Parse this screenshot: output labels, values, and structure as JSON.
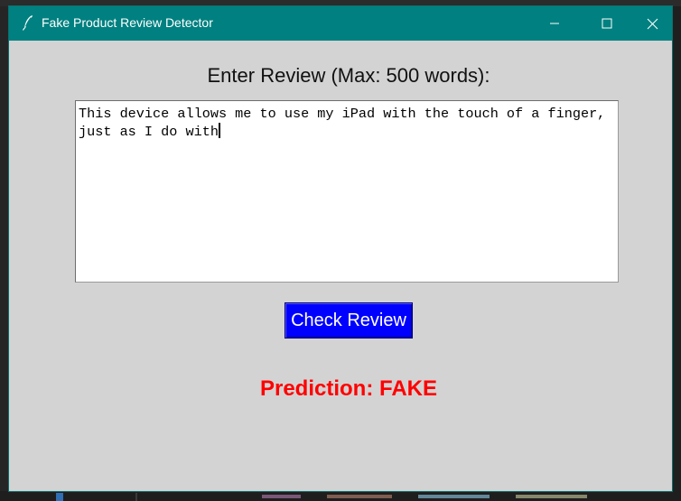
{
  "window": {
    "title": "Fake Product Review Detector",
    "titlebar_color": "#008080",
    "background_color": "#d3d3d3",
    "icons": {
      "app": "feather-icon",
      "minimize": "minimize-icon",
      "maximize": "maximize-icon",
      "close": "close-icon"
    }
  },
  "form": {
    "prompt_label": "Enter Review (Max: 500 words):",
    "review_text": "This device allows me to use my iPad with the touch of a finger, just as I do with",
    "check_button_label": "Check Review",
    "check_button_color": "#0000ff"
  },
  "result": {
    "prediction_text": "Prediction: FAKE",
    "prediction_color": "#ff0000"
  }
}
